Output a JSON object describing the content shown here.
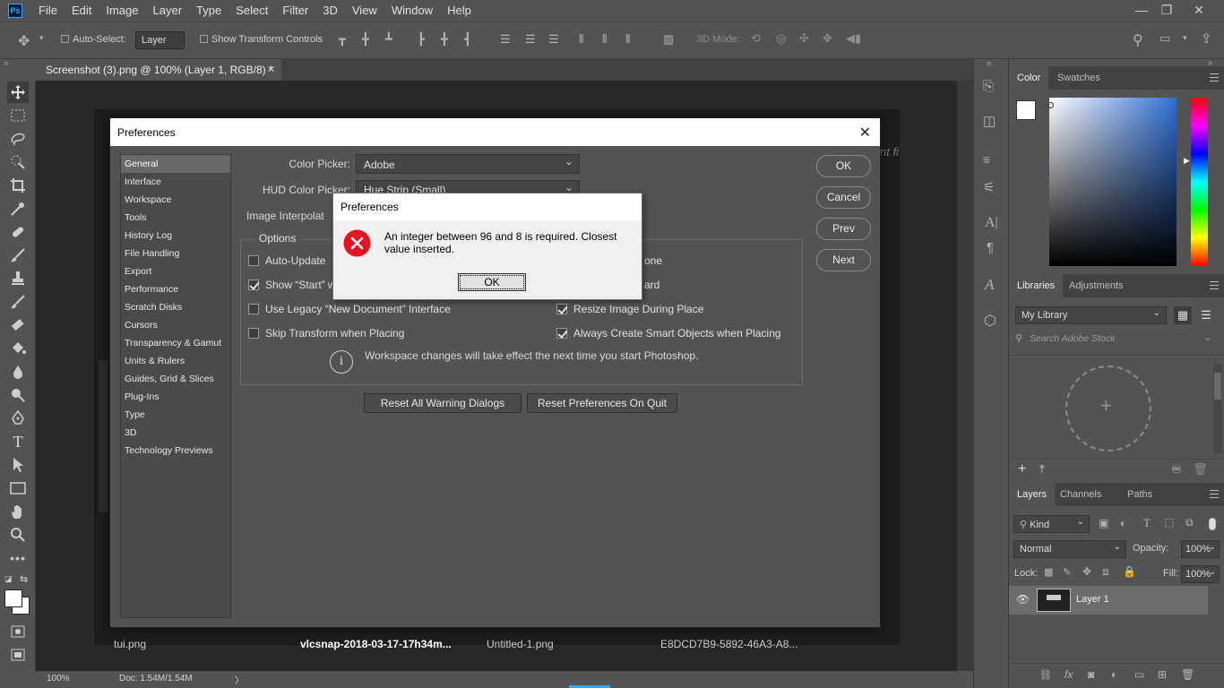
{
  "app": {
    "logo": "Ps"
  },
  "menubar": [
    "File",
    "Edit",
    "Image",
    "Layer",
    "Type",
    "Select",
    "Filter",
    "3D",
    "View",
    "Window",
    "Help"
  ],
  "window_controls": {
    "minimize": "—",
    "restore": "❐",
    "close": "✕"
  },
  "options_bar": {
    "auto_select_label": "Auto-Select:",
    "auto_select_value": "Layer",
    "show_transform_label": "Show Transform Controls",
    "mode_3d_label": "3D Mode:"
  },
  "document_tab": {
    "title": "Screenshot (3).png @ 100% (Layer 1, RGB/8) *",
    "close": "✕"
  },
  "canvas_thumbs": [
    "tui.png",
    "vlcsnap-2018-03-17-17h34m...",
    "Untitled-1.png",
    "E8DCD7B9-5892-46A3-A8..."
  ],
  "canvas_partial_text": "nt fi",
  "status_bar": {
    "zoom": "100%",
    "doc": "Doc: 1.54M/1.54M",
    "arrow": "〉"
  },
  "color_panel": {
    "tabs": [
      "Color",
      "Swatches"
    ],
    "active": "Color",
    "accent_hue": "#2f6fd6"
  },
  "libraries_panel": {
    "tabs": [
      "Libraries",
      "Adjustments"
    ],
    "active": "Libraries",
    "library_select": "My Library",
    "search_placeholder": "Search Adobe Stock",
    "add_glyph": "+"
  },
  "layers_panel": {
    "tabs": [
      "Layers",
      "Channels",
      "Paths"
    ],
    "active": "Layers",
    "kind_label": "Kind",
    "blend_mode": "Normal",
    "opacity_label": "Opacity:",
    "opacity_value": "100%",
    "lock_label": "Lock:",
    "fill_label": "Fill:",
    "fill_value": "100%",
    "layers": [
      {
        "name": "Layer 1",
        "visible": true
      }
    ]
  },
  "preferences": {
    "title": "Preferences",
    "close_glyph": "✕",
    "categories": [
      "General",
      "Interface",
      "Workspace",
      "Tools",
      "History Log",
      "File Handling",
      "Export",
      "Performance",
      "Scratch Disks",
      "Cursors",
      "Transparency & Gamut",
      "Units & Rulers",
      "Guides, Grid & Slices",
      "Plug-Ins",
      "Type",
      "3D",
      "Technology Previews"
    ],
    "selected_category": "General",
    "color_picker_label": "Color Picker:",
    "color_picker_value": "Adobe",
    "hud_label": "HUD Color Picker:",
    "hud_value": "Hue Strip (Small)",
    "interp_label": "Image Interpolat",
    "options_legend": "Options",
    "options_left": [
      {
        "label": "Auto-Update",
        "checked": false
      },
      {
        "label": "Show “Start” w",
        "checked": true
      },
      {
        "label": "Use Legacy “New Document” Interface",
        "checked": false
      },
      {
        "label": "Skip Transform when Placing",
        "checked": false
      }
    ],
    "options_right": [
      {
        "label": "one",
        "checked": null
      },
      {
        "label": "ard",
        "checked": null
      },
      {
        "label": "Resize Image During Place",
        "checked": true
      },
      {
        "label": "Always Create Smart Objects when Placing",
        "checked": true
      }
    ],
    "info_text": "Workspace changes will take effect the next time you start Photoshop.",
    "reset_warnings": "Reset All Warning Dialogs",
    "reset_on_quit": "Reset Preferences On Quit",
    "buttons": {
      "ok": "OK",
      "cancel": "Cancel",
      "prev": "Prev",
      "next": "Next"
    }
  },
  "alert": {
    "title": "Preferences",
    "message": "An integer between 96 and 8 is required.  Closest value inserted.",
    "ok": "OK",
    "icon_color": "#e81123"
  }
}
